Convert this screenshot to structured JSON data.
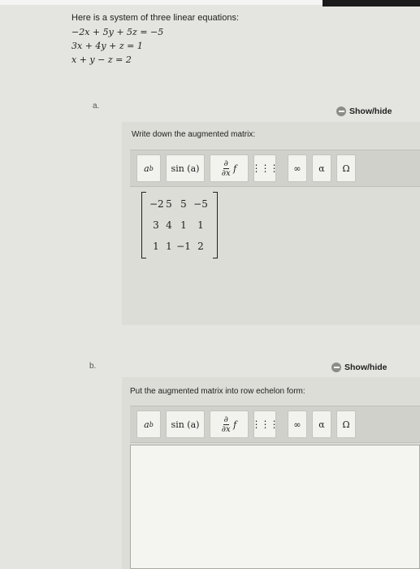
{
  "intro": "Here is a system of three linear equations:",
  "equations": [
    "−2x + 5y + 5z = −5",
    "3x + 4y + z = 1",
    "x + y − z = 2"
  ],
  "part_a": {
    "label": "a.",
    "showhide": "Show/hide",
    "prompt": "Write down the augmented matrix:",
    "matrix": [
      [
        "−2",
        "5",
        "5",
        "−5"
      ],
      [
        "3",
        "4",
        "1",
        "1"
      ],
      [
        "1",
        "1",
        "−1",
        "2"
      ]
    ]
  },
  "part_b": {
    "label": "b.",
    "showhide": "Show/hide",
    "prompt": "Put the augmented matrix into row echelon form:"
  },
  "toolbar": {
    "power": "a",
    "power_sup": "b",
    "sin": "sin (a)",
    "deriv_num": "∂",
    "deriv_den": "∂x",
    "deriv_f": "f",
    "grid": "⋮⋮⋮",
    "infinity": "∞",
    "alpha": "α",
    "omega": "Ω"
  }
}
